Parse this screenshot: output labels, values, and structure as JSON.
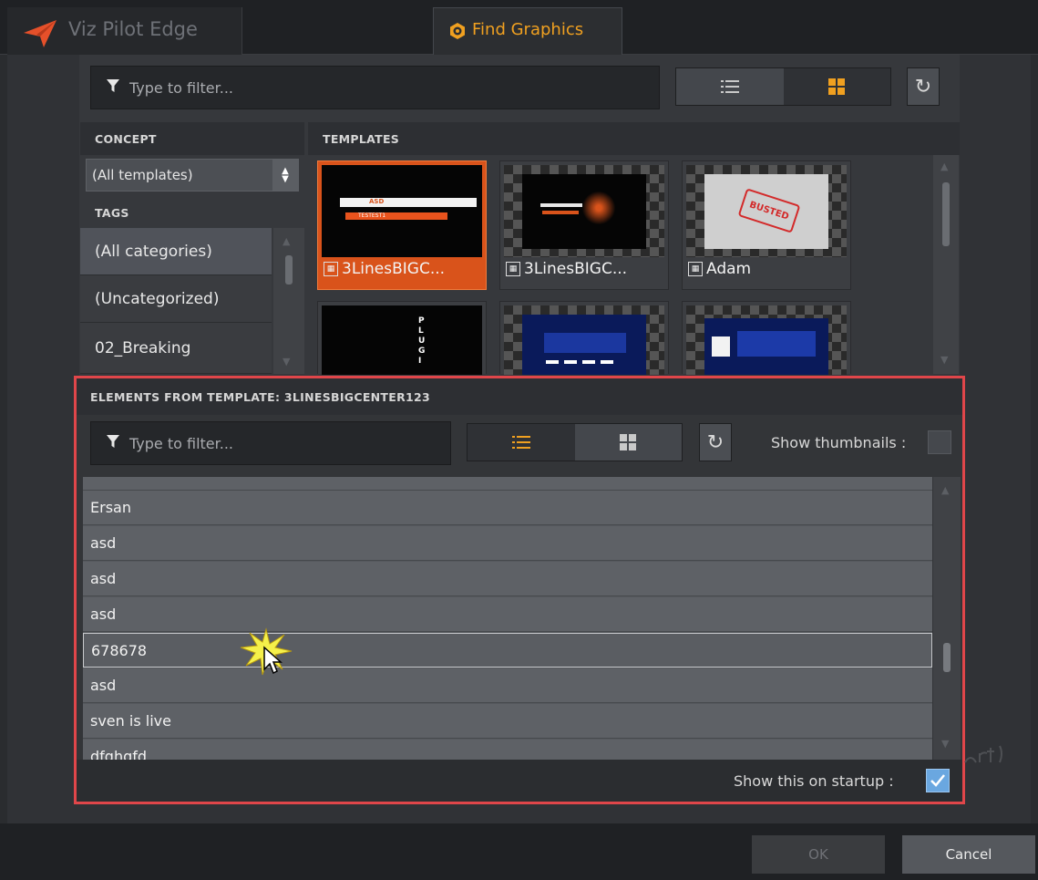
{
  "app": {
    "title": "Viz Pilot Edge"
  },
  "tabs": {
    "find_graphics": "Find Graphics"
  },
  "template_filter": {
    "placeholder": "Type to filter..."
  },
  "concept": {
    "heading": "CONCEPT",
    "selected": "(All templates)"
  },
  "tags": {
    "heading": "TAGS",
    "items": [
      "(All categories)",
      "(Uncategorized)",
      "02_Breaking"
    ]
  },
  "templates": {
    "heading": "TEMPLATES",
    "items": [
      {
        "label": "3LinesBIGC...",
        "selected": true
      },
      {
        "label": "3LinesBIGC...",
        "selected": false
      },
      {
        "label": "Adam",
        "selected": false
      },
      {
        "label": "",
        "selected": false
      },
      {
        "label": "",
        "selected": false
      },
      {
        "label": "",
        "selected": false
      }
    ],
    "thumb_text": {
      "plug": "PLUGI",
      "busted": "BUSTED",
      "asd": "ASD",
      "testest": "TESTEST1"
    }
  },
  "elements": {
    "heading": "ELEMENTS FROM TEMPLATE: 3LINESBIGCENTER123",
    "filter_placeholder": "Type to filter...",
    "show_thumbnails_label": "Show thumbnails :",
    "show_thumbnails_checked": false,
    "rows": [
      "Ersan",
      "asd",
      "asd",
      "asd",
      "678678",
      "asd",
      "sven is live",
      "dfghgfd"
    ],
    "selected_row": "678678",
    "startup_label": "Show this on startup :",
    "startup_checked": true
  },
  "buttons": {
    "ok": "OK",
    "cancel": "Cancel"
  },
  "colors": {
    "accent": "#f0a020",
    "highlight_border": "#e0464a",
    "selected_thumb": "#d9531b",
    "checkbox": "#6aa7e0"
  }
}
